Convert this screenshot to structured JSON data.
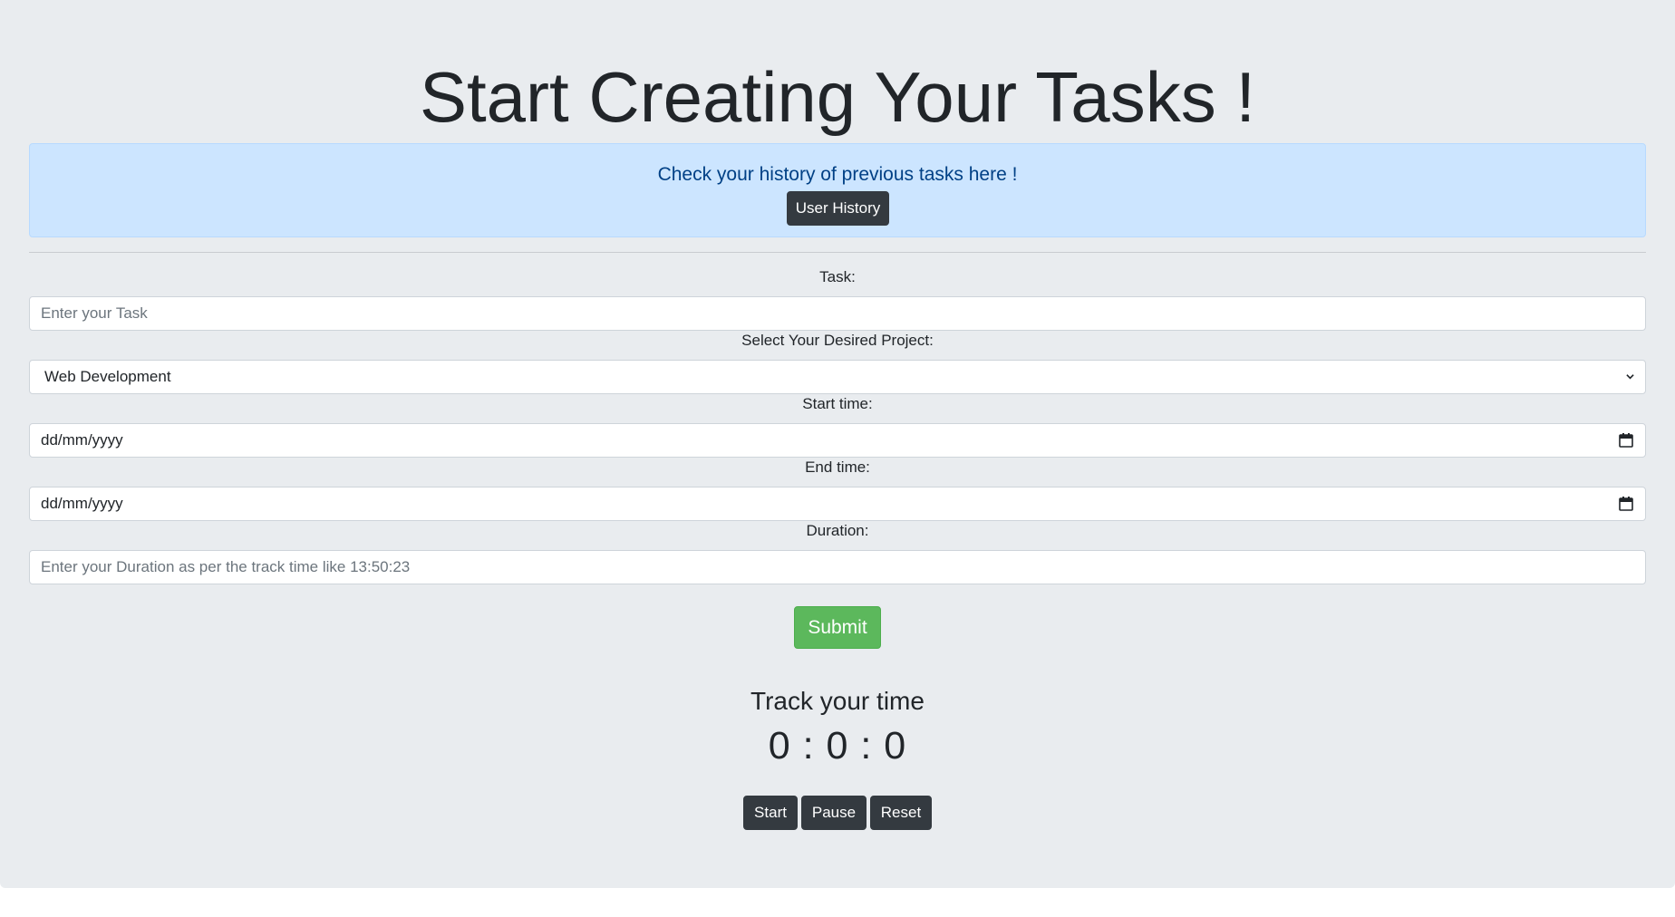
{
  "page": {
    "title": "Start Creating Your Tasks !"
  },
  "history_alert": {
    "text": "Check your history of previous tasks here !",
    "button_label": "User History"
  },
  "form": {
    "task": {
      "label": "Task:",
      "placeholder": "Enter your Task"
    },
    "project": {
      "label": "Select Your Desired Project:",
      "selected": "Web Development"
    },
    "start_time": {
      "label": "Start time:",
      "value": "dd/mm/yyyy"
    },
    "end_time": {
      "label": "End time:",
      "value": "dd/mm/yyyy"
    },
    "duration": {
      "label": "Duration:",
      "placeholder": "Enter your Duration as per the track time like 13:50:23"
    },
    "submit_label": "Submit"
  },
  "tracker": {
    "heading": "Track your time",
    "display": "0 : 0 : 0",
    "start_label": "Start",
    "pause_label": "Pause",
    "reset_label": "Reset"
  },
  "colors": {
    "background": "#e9ecef",
    "alert_background": "#cce5ff",
    "alert_text": "#004085",
    "dark_button": "#343a40",
    "submit_button": "#5cb85c"
  },
  "icons": {
    "select": "chevron-down-icon",
    "date": "calendar-icon"
  }
}
